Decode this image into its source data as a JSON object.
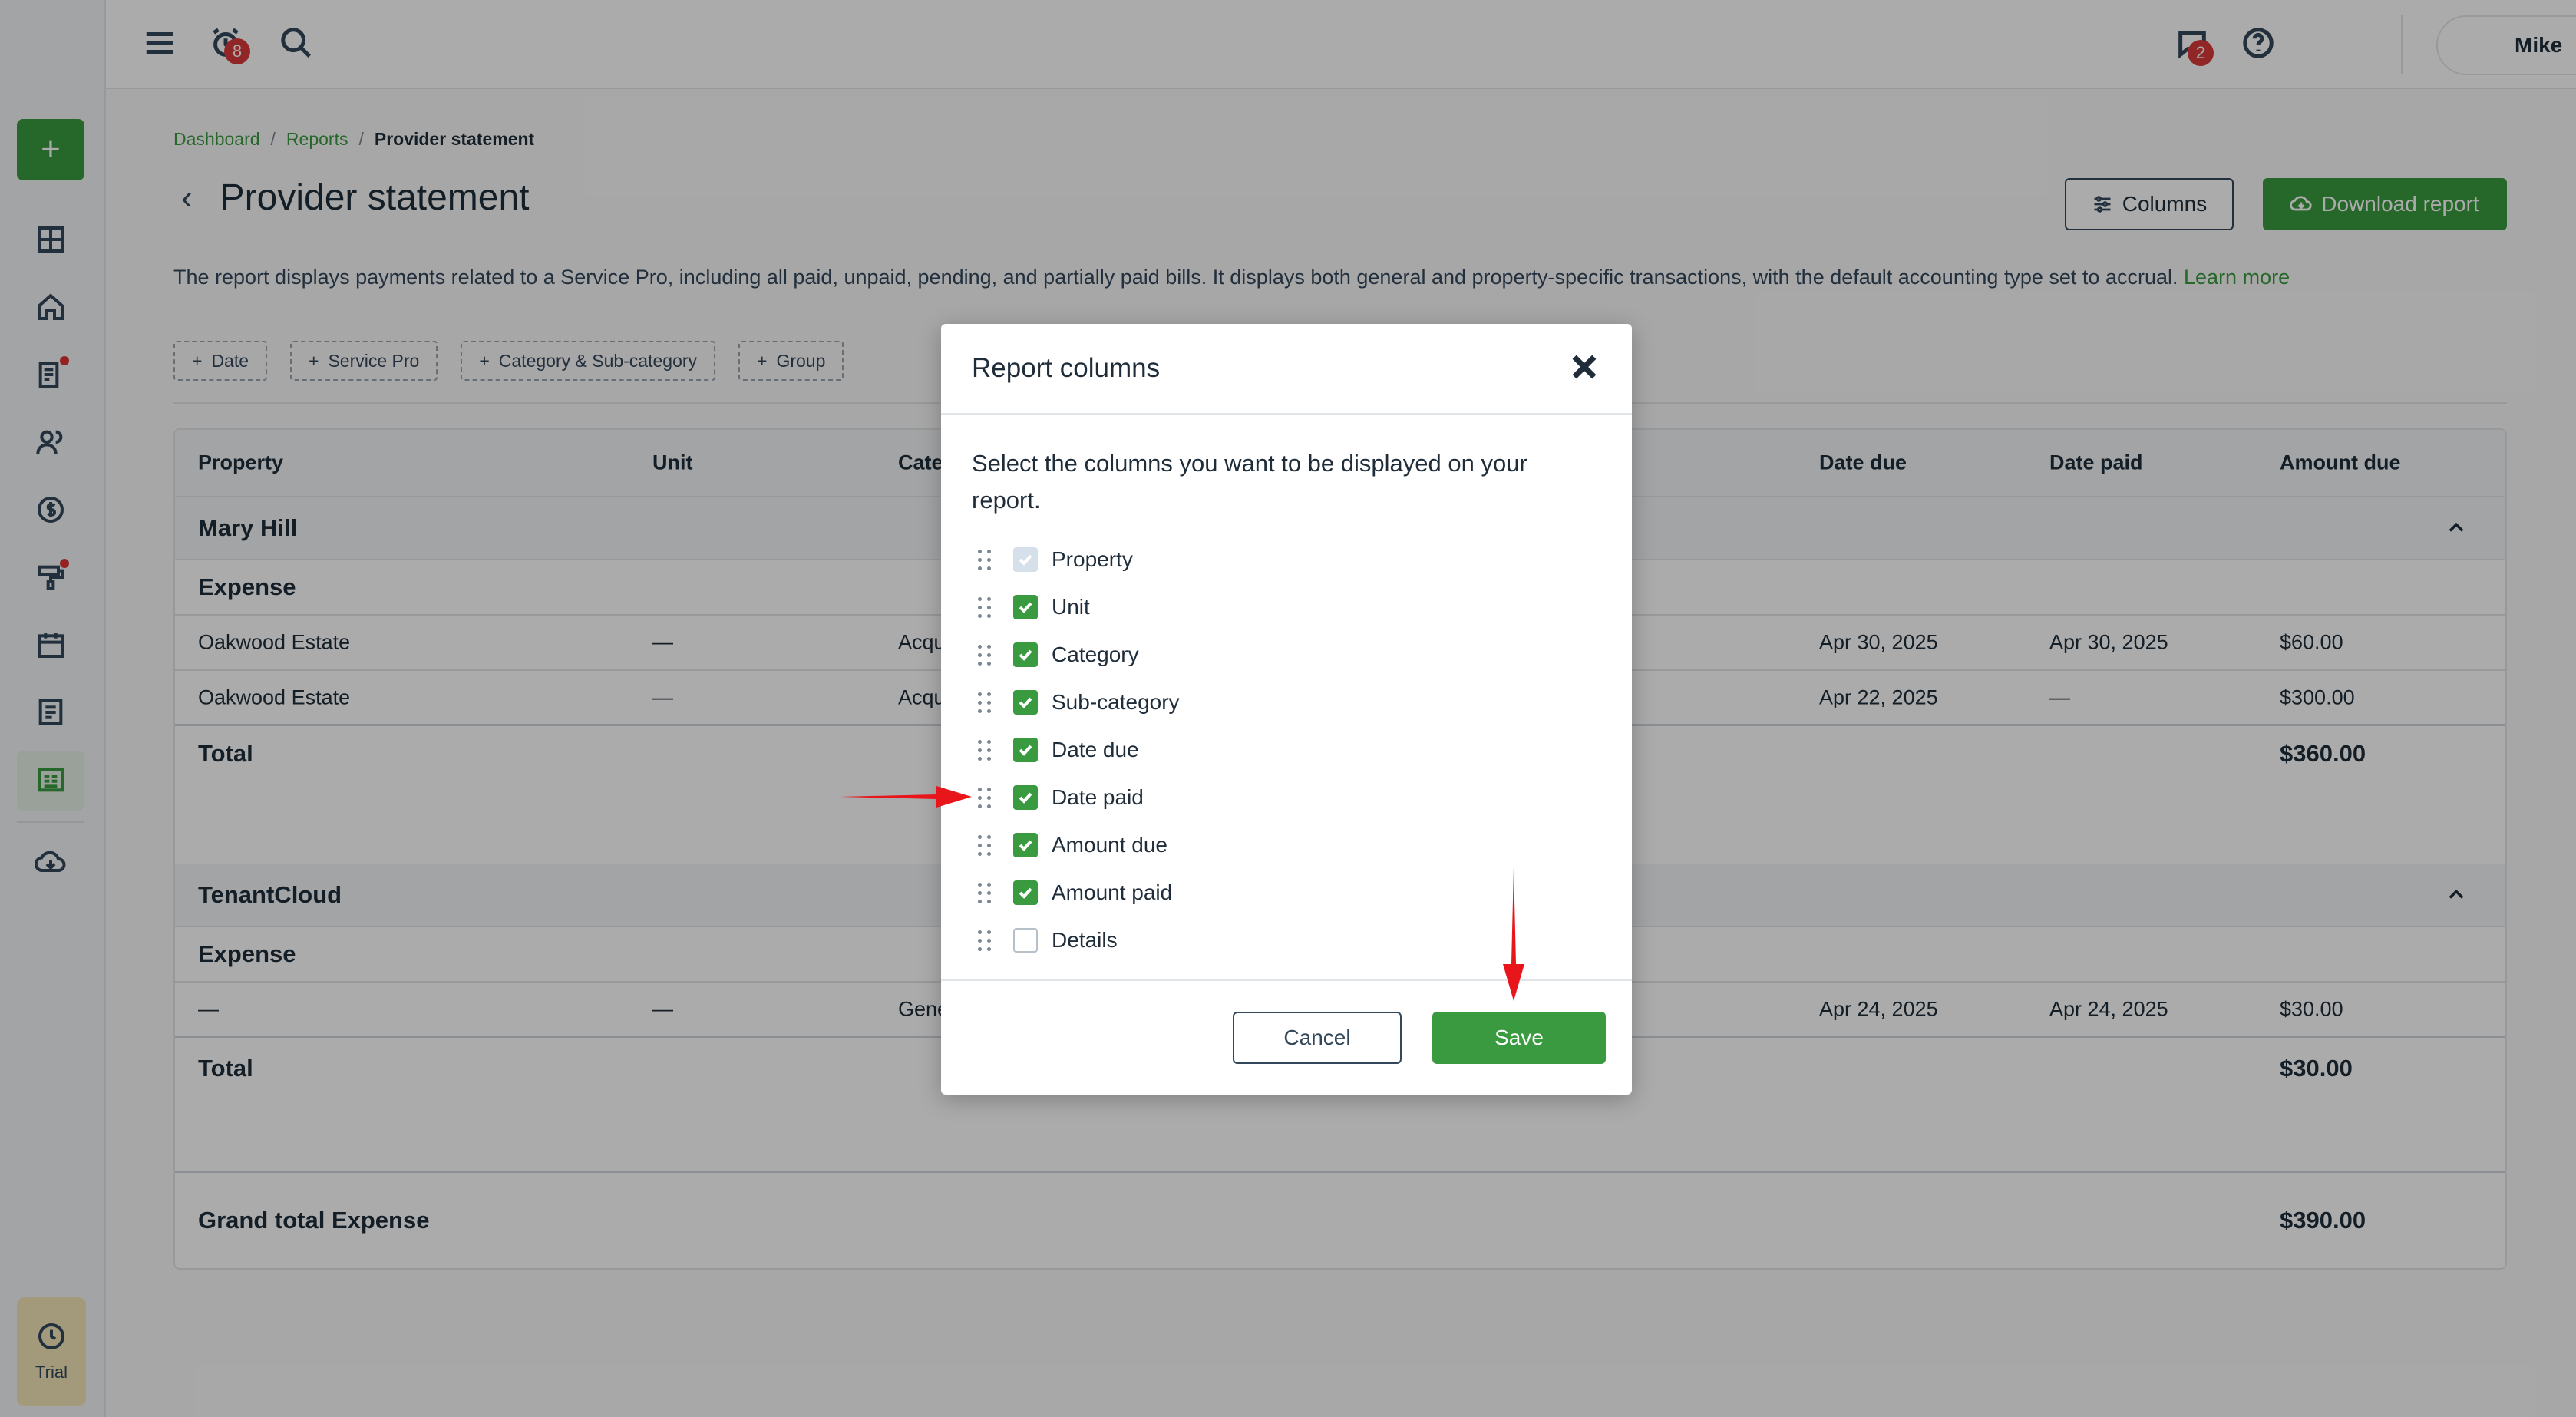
{
  "topbar": {
    "notifications_count": "8",
    "messages_count": "2",
    "user_name": "Mike"
  },
  "sidebar": {
    "add_label": "+",
    "trial_label": "Trial"
  },
  "breadcrumb": {
    "items": [
      "Dashboard",
      "Reports",
      "Provider statement"
    ],
    "sep": "/"
  },
  "page": {
    "back_glyph": "‹",
    "title": "Provider statement",
    "columns_button": "Columns",
    "download_button": "Download report",
    "description": "The report displays payments related to a Service Pro, including all paid, unpaid, pending, and partially paid bills. It displays both general and property-specific transactions, with the default accounting type set to accrual.",
    "learn_more": "Learn more"
  },
  "filters": [
    "Date",
    "Service Pro",
    "Category & Sub-category",
    "Group"
  ],
  "table": {
    "headers": [
      "Property",
      "Unit",
      "Cate",
      "Date due",
      "Date paid",
      "Amount due"
    ],
    "groups": [
      {
        "name": "Mary Hill",
        "section": "Expense",
        "rows": [
          [
            "Oakwood Estate",
            "—",
            "Acqu",
            "Apr 30, 2025",
            "Apr 30, 2025",
            "$60.00"
          ],
          [
            "Oakwood Estate",
            "—",
            "Acqu",
            "Apr 22, 2025",
            "—",
            "$300.00"
          ]
        ],
        "total_label": "Total",
        "total": "$360.00"
      },
      {
        "name": "TenantCloud",
        "section": "Expense",
        "rows": [
          [
            "—",
            "—",
            "Gene",
            "Apr 24, 2025",
            "Apr 24, 2025",
            "$30.00"
          ]
        ],
        "total_label": "Total",
        "total": "$30.00"
      }
    ],
    "grand_total_label": "Grand total Expense",
    "grand_total": "$390.00"
  },
  "modal": {
    "title": "Report columns",
    "text": "Select the columns you want to be displayed on your report.",
    "columns": [
      {
        "label": "Property",
        "state": "disabled"
      },
      {
        "label": "Unit",
        "state": "on"
      },
      {
        "label": "Category",
        "state": "on"
      },
      {
        "label": "Sub-category",
        "state": "on"
      },
      {
        "label": "Date due",
        "state": "on"
      },
      {
        "label": "Date paid",
        "state": "on"
      },
      {
        "label": "Amount due",
        "state": "on"
      },
      {
        "label": "Amount paid",
        "state": "on"
      },
      {
        "label": "Details",
        "state": "off"
      }
    ],
    "cancel": "Cancel",
    "save": "Save"
  },
  "colors": {
    "accent": "#3a9a3f",
    "badge": "#d93a3a",
    "annotation_arrow": "#e8151b"
  }
}
